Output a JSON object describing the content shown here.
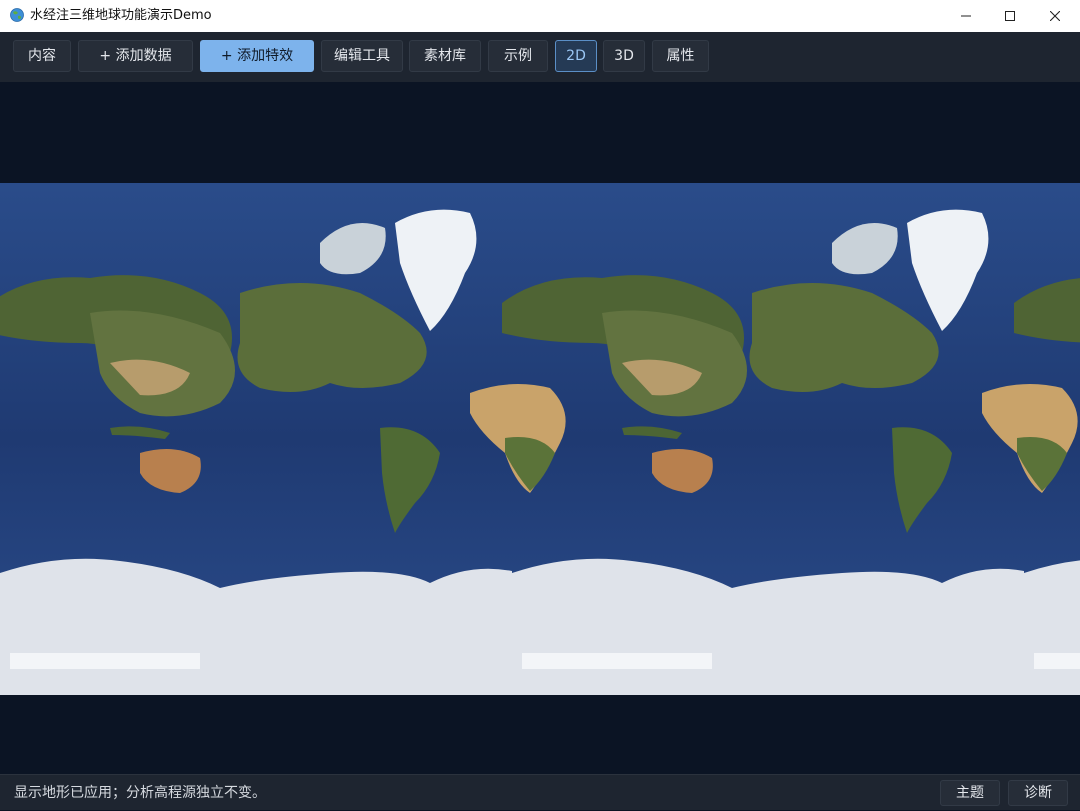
{
  "window": {
    "title": "水经注三维地球功能演示Demo",
    "icon": "globe-icon",
    "controls": [
      "minimize-icon",
      "maximize-icon",
      "close-icon"
    ]
  },
  "toolbar": {
    "content": "内容",
    "add_data": "+ 添加数据",
    "add_effects": "+ 添加特效",
    "edit_tools": "编辑工具",
    "material_library": "素材库",
    "examples": "示例",
    "view_2d": "2D",
    "view_3d": "3D",
    "properties": "属性",
    "active_view": "2D"
  },
  "map": {
    "projection_view": "2D",
    "colors": {
      "space": "#0b1424",
      "ocean": "#243f7a",
      "land": "#5b6e3a",
      "desert": "#c9a36a",
      "ice": "#dfe3ea"
    }
  },
  "status": {
    "message": "显示地形已应用；分析高程源独立不变。",
    "theme_button": "主题",
    "diagnose_button": "诊断"
  },
  "colors": {
    "accent": "#7db3ec",
    "active_border": "#5b8fc7",
    "toolbar_bg": "#1e2530"
  }
}
